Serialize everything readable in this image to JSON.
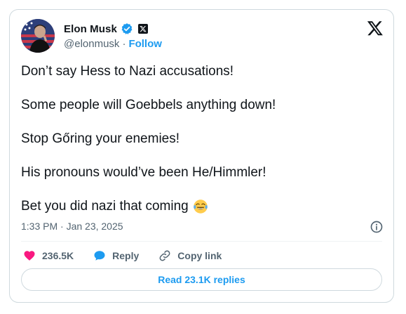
{
  "author": {
    "name": "Elon Musk",
    "handle": "@elonmusk",
    "separator": "·",
    "follow_label": "Follow",
    "verified_icon": "verified-badge-icon",
    "affiliation_icon": "x-affiliate-icon"
  },
  "tweet": {
    "lines": [
      "Don’t say Hess to Nazi accusations!",
      "Some people will Goebbels anything down!",
      "Stop Gőring your enemies!",
      "His pronouns would’ve been He/Himmler!",
      "Bet you did nazi that coming"
    ],
    "end_emoji_icon": "tears-of-joy-emoji-icon"
  },
  "timestamp": "1:33 PM · Jan 23, 2025",
  "actions": {
    "like_count": "236.5K",
    "reply_label": "Reply",
    "copy_link_label": "Copy link"
  },
  "read_replies_label": "Read 23.1K replies",
  "colors": {
    "accent": "#1d9bf0",
    "like": "#f91880",
    "text": "#0f1419",
    "secondary": "#536471",
    "border": "#cfd9de"
  }
}
